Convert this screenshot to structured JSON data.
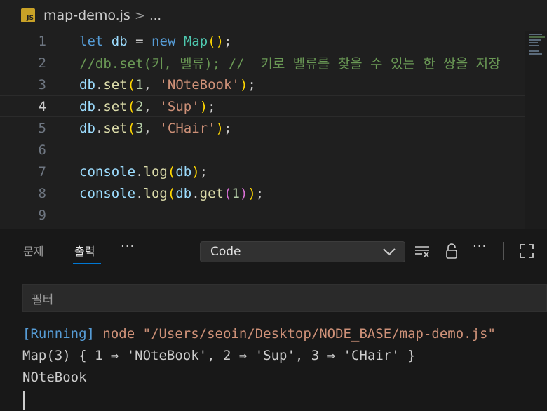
{
  "breadcrumb": {
    "file_icon": "JS",
    "file_name": "map-demo.js",
    "separator": ">",
    "more": "..."
  },
  "editor": {
    "lines": [
      {
        "n": "1"
      },
      {
        "n": "2"
      },
      {
        "n": "3"
      },
      {
        "n": "4"
      },
      {
        "n": "5"
      },
      {
        "n": "6"
      },
      {
        "n": "7"
      },
      {
        "n": "8"
      },
      {
        "n": "9"
      }
    ],
    "current_line": "4",
    "tokens": {
      "l1": [
        "let",
        "db",
        "=",
        "new",
        "Map",
        "(",
        ")",
        ";"
      ],
      "l2_comment": "//db.set(키, 벨류); //  키로 벨류를 찾을 수 있는 한 쌍을 저장",
      "l3": [
        "db",
        ".",
        "set",
        "(",
        "1",
        ", ",
        "'NOteBook'",
        ")",
        ";"
      ],
      "l4": [
        "db",
        ".",
        "set",
        "(",
        "2",
        ", ",
        "'Sup'",
        ")",
        ";"
      ],
      "l5": [
        "db",
        ".",
        "set",
        "(",
        "3",
        ", ",
        "'CHair'",
        ")",
        ";"
      ],
      "l7": [
        "console",
        ".",
        "log",
        "(",
        "db",
        ")",
        ";"
      ],
      "l8": [
        "console",
        ".",
        "log",
        "(",
        "db",
        ".",
        "get",
        "(",
        "1",
        ")",
        ")",
        ";"
      ]
    }
  },
  "panel": {
    "tabs": [
      {
        "label": "문제"
      },
      {
        "label": "출력"
      }
    ],
    "more": "···",
    "output_channel": "Code",
    "filter_placeholder": "필터",
    "output": {
      "running_tag": "[Running]",
      "command": " node \"/Users/seoin/Desktop/NODE_BASE/map-demo.js\"",
      "line2": "Map(3) { 1 ⇒ 'NOteBook', 2 ⇒ 'Sup', 3 ⇒ 'CHair' }",
      "line3": "NOteBook"
    }
  },
  "colors": {
    "keyword": "#569cd6",
    "class": "#4ec9b0",
    "function": "#dcdcaa",
    "string": "#ce9178",
    "comment": "#6a9955",
    "accent": "#0078d4"
  }
}
